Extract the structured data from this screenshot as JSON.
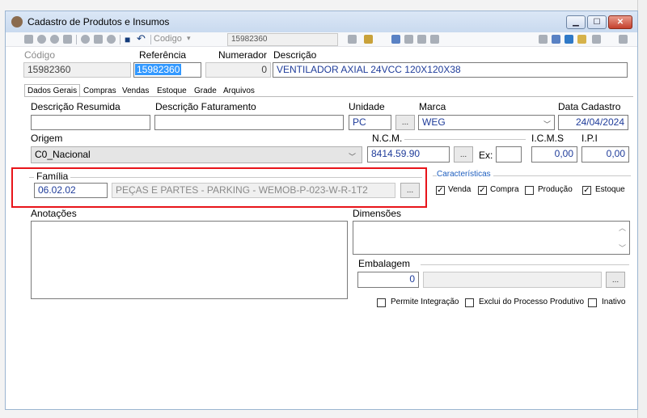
{
  "window": {
    "title": "Cadastro de Produtos e Insumos"
  },
  "toolbar": {
    "codigo_label": "Codigo",
    "codigo_value": "15982360"
  },
  "header": {
    "codigo_label": "Código",
    "codigo_value": "15982360",
    "referencia_label": "Referência",
    "referencia_value": "15982360",
    "numerador_label": "Numerador",
    "numerador_value": "0",
    "descricao_label": "Descrição",
    "descricao_value": "VENTILADOR AXIAL 24VCC 120X120X38"
  },
  "tabs": [
    {
      "label": "Dados Gerais"
    },
    {
      "label": "Compras"
    },
    {
      "label": "Vendas"
    },
    {
      "label": "Estoque"
    },
    {
      "label": "Grade"
    },
    {
      "label": "Arquivos"
    }
  ],
  "form": {
    "descricao_resumida_label": "Descrição Resumida",
    "descricao_faturamento_label": "Descrição Faturamento",
    "unidade_label": "Unidade",
    "unidade_value": "PC",
    "marca_label": "Marca",
    "marca_value": "WEG",
    "data_cadastro_label": "Data Cadastro",
    "data_cadastro_value": "24/04/2024",
    "origem_label": "Origem",
    "origem_value": "C0_Nacional",
    "ncm_label": "N.C.M.",
    "ncm_value": "8414.59.90",
    "ex_label": "Ex:",
    "icms_label": "I.C.M.S",
    "icms_value": "0,00",
    "ipi_label": "I.P.I",
    "ipi_value": "0,00",
    "familia_label": "Família",
    "familia_code": "06.02.02",
    "familia_desc": "PEÇAS E PARTES - PARKING - WEMOB-P-023-W-R-1T2",
    "caracteristicas_label": "Características",
    "caracteristicas": [
      {
        "label": "Venda",
        "checked": true
      },
      {
        "label": "Compra",
        "checked": true
      },
      {
        "label": "Produção",
        "checked": false
      },
      {
        "label": "Estoque",
        "checked": true
      }
    ],
    "anotacoes_label": "Anotações",
    "dimensoes_label": "Dimensões",
    "embalagem_label": "Embalagem",
    "embalagem_value": "0",
    "flags": [
      {
        "label": "Permite Integração",
        "checked": false
      },
      {
        "label": "Exclui do Processo Produtivo",
        "checked": false
      },
      {
        "label": "Inativo",
        "checked": false
      }
    ],
    "dots": "...",
    "check_mark": "✓"
  },
  "colors": {
    "highlight": "#e8141a",
    "field_text": "#1f3c9a",
    "selection": "#3399ff"
  }
}
